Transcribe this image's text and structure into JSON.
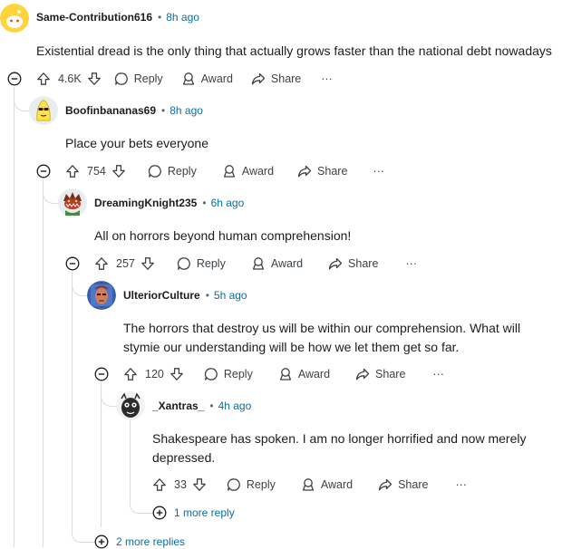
{
  "comments": [
    {
      "author": "Same-Contribution616",
      "time": "8h ago",
      "lines": [
        "Existential dread is the only thing that actually grows faster than the national debt nowadays"
      ],
      "votes": "4.6K"
    },
    {
      "author": "Boofinbananas69",
      "time": "8h ago",
      "lines": [
        "Place your bets everyone"
      ],
      "votes": "754"
    },
    {
      "author": "DreamingKnight235",
      "time": "6h ago",
      "lines": [
        "All on horrors beyond human comprehension!"
      ],
      "votes": "257"
    },
    {
      "author": "UlteriorCulture",
      "time": "5h ago",
      "lines": [
        "The horrors that destroy us will be within our comprehension. What will",
        "stymie our understanding will be how we let them get so far."
      ],
      "votes": "120"
    },
    {
      "author": "_Xantras_",
      "time": "4h ago",
      "lines": [
        "Shakespeare has spoken. I am no longer horrified and now merely",
        "depressed."
      ],
      "votes": "33"
    }
  ],
  "actions": {
    "reply": "Reply",
    "award": "Award",
    "share": "Share",
    "overflow": "···"
  },
  "more_replies": {
    "level5": "1 more reply",
    "level1": "2 more replies"
  },
  "icons": {
    "upvote": "arrow-up-icon",
    "downvote": "arrow-down-icon",
    "reply": "speech-bubble-icon",
    "award": "award-icon",
    "share": "share-arrow-icon",
    "collapse": "minus-circle-icon",
    "expand": "plus-circle-icon"
  },
  "colors": {
    "link": "#0a6e9e",
    "thread": "#dadcdd",
    "text": "#1c1c1c",
    "muted": "#576f76"
  }
}
